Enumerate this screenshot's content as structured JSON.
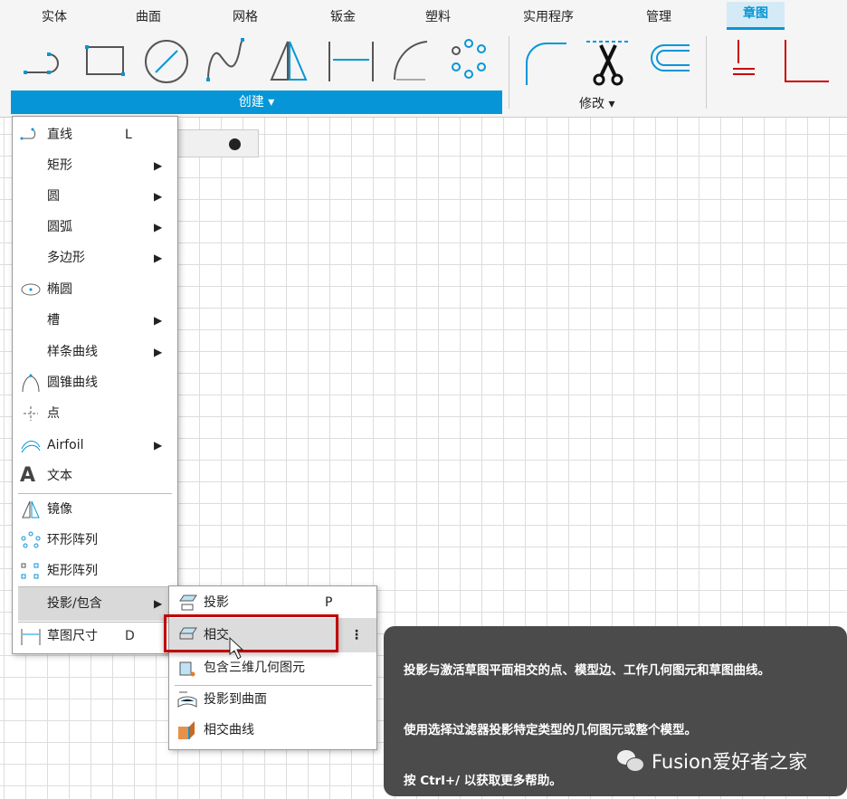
{
  "tabs": [
    "实体",
    "曲面",
    "网格",
    "钣金",
    "塑料",
    "实用程序",
    "管理",
    "章图"
  ],
  "active_tab": "章图",
  "create_label": "创建 ▾",
  "modify_label": "修改 ▾",
  "menu": {
    "items": [
      {
        "label": "直线",
        "shortcut": "L",
        "icon": "line-icon"
      },
      {
        "label": "矩形",
        "submenu": "▶"
      },
      {
        "label": "圆",
        "submenu": "▶"
      },
      {
        "label": "圆弧",
        "submenu": "▶"
      },
      {
        "label": "多边形",
        "submenu": "▶"
      },
      {
        "label": "椭圆",
        "icon": "ellipse-icon"
      },
      {
        "label": "槽",
        "submenu": "▶"
      },
      {
        "label": "样条曲线",
        "submenu": "▶"
      },
      {
        "label": "圆锥曲线",
        "icon": "conic-icon"
      },
      {
        "label": "点",
        "icon": "point-icon"
      },
      {
        "label": "Airfoil",
        "submenu": "▶",
        "icon": "airfoil-icon"
      },
      {
        "label": "文本",
        "icon": "text-icon"
      },
      {
        "label": "镜像",
        "icon": "mirror-icon"
      },
      {
        "label": "环形阵列",
        "icon": "circular-pattern-icon"
      },
      {
        "label": "矩形阵列",
        "icon": "rectangular-pattern-icon"
      },
      {
        "label": "投影/包含",
        "submenu": "▶"
      },
      {
        "label": "草图尺寸",
        "shortcut": "D",
        "icon": "dimension-icon"
      }
    ]
  },
  "submenu": {
    "items": [
      {
        "label": "投影",
        "shortcut": "P"
      },
      {
        "label": "相交",
        "more": "⋮"
      },
      {
        "label": "包含三维几何图元"
      },
      {
        "label": "投影到曲面"
      },
      {
        "label": "相交曲线"
      }
    ]
  },
  "tooltip": {
    "line1": "投影与激活草图平面相交的点、模型边、工作几何图元和草图曲线。",
    "line2": "使用选择过滤器投影特定类型的几何图元或整个模型。",
    "line3": "按 Ctrl+/ 以获取更多帮助。"
  },
  "watermark": "Fusion爱好者之家",
  "colors": {
    "accent": "#0696d7",
    "highlight_box": "#c00000",
    "tooltip_bg": "#4b4b4b"
  }
}
